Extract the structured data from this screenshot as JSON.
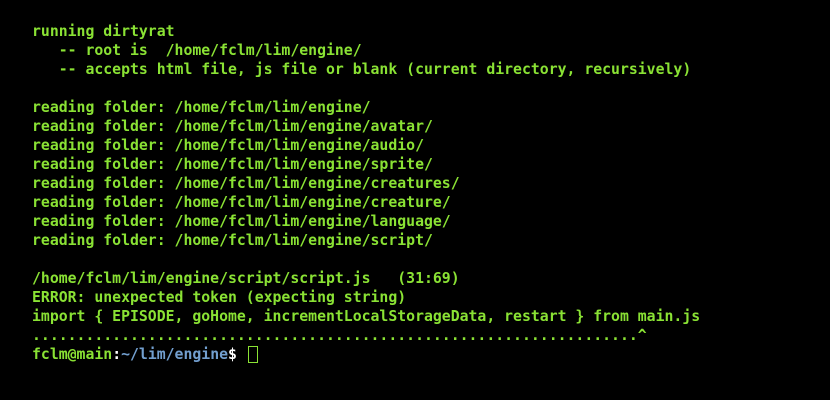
{
  "colors": {
    "background": "#000000",
    "output_text": "#8ae234",
    "prompt_user": "#8ae234",
    "prompt_path": "#729fcf",
    "prompt_symbols": "#ffffff",
    "cursor": "#8ae234"
  },
  "intro": {
    "line1": "running dirtyrat",
    "line2": "   -- root is  /home/fclm/lim/engine/",
    "line3": "   -- accepts html file, js file or blank (current directory, recursively)"
  },
  "folders": [
    "reading folder: /home/fclm/lim/engine/",
    "reading folder: /home/fclm/lim/engine/avatar/",
    "reading folder: /home/fclm/lim/engine/audio/",
    "reading folder: /home/fclm/lim/engine/sprite/",
    "reading folder: /home/fclm/lim/engine/creatures/",
    "reading folder: /home/fclm/lim/engine/creature/",
    "reading folder: /home/fclm/lim/engine/language/",
    "reading folder: /home/fclm/lim/engine/script/"
  ],
  "error": {
    "location": "/home/fclm/lim/engine/script/script.js   (31:69)",
    "message": "ERROR: unexpected token (expecting string)",
    "source_line": "import { EPISODE, goHome, incrementLocalStorageData, restart } from main.js",
    "pointer_line": "....................................................................^"
  },
  "prompt": {
    "user_host": "fclm@main",
    "separator": ":",
    "path": "~/lim/engine",
    "symbol": "$ "
  }
}
